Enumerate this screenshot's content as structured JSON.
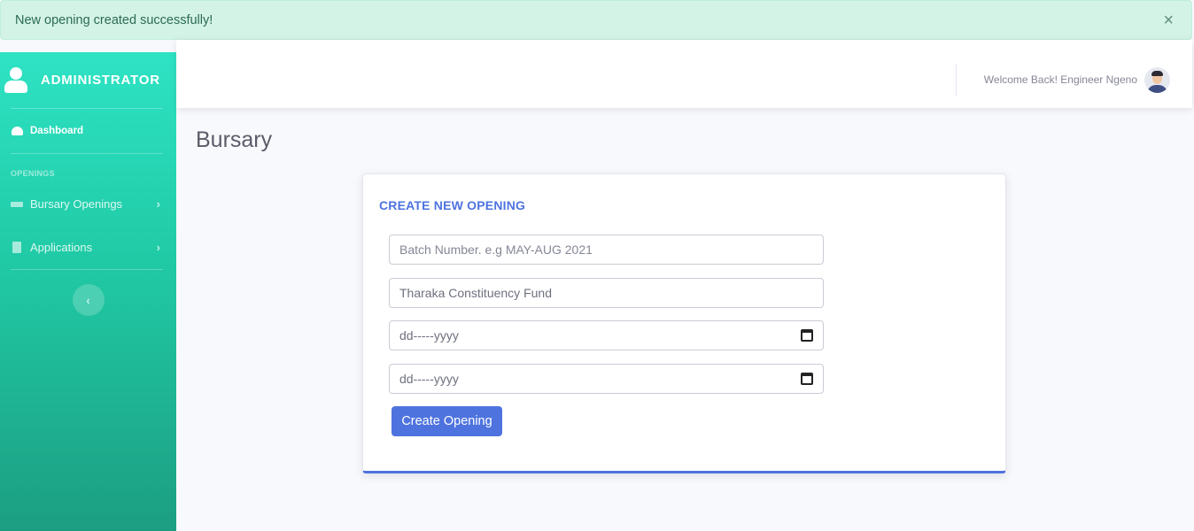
{
  "alert": {
    "message": "New opening created successfully!",
    "close_label": "×"
  },
  "sidebar": {
    "brand": "ADMINISTRATOR",
    "dashboard": "Dashboard",
    "section_heading": "OPENINGS",
    "items": [
      {
        "label": "Bursary Openings",
        "icon": "bed-icon"
      },
      {
        "label": "Applications",
        "icon": "file-icon"
      }
    ],
    "chevron": "›",
    "toggle": "‹"
  },
  "topbar": {
    "welcome": "Welcome Back! Engineer Ngeno"
  },
  "page": {
    "title": "Bursary"
  },
  "form": {
    "title": "CREATE NEW OPENING",
    "batch_placeholder": "Batch Number. e.g MAY-AUG 2021",
    "fund_value": "Tharaka Constituency Fund",
    "start_date": "dd-----yyyy",
    "end_date": "dd-----yyyy",
    "submit_label": "Create Opening"
  },
  "colors": {
    "primary": "#4e73df",
    "sidebar": "#20c9a4",
    "alert_bg": "#d4f3e7"
  }
}
